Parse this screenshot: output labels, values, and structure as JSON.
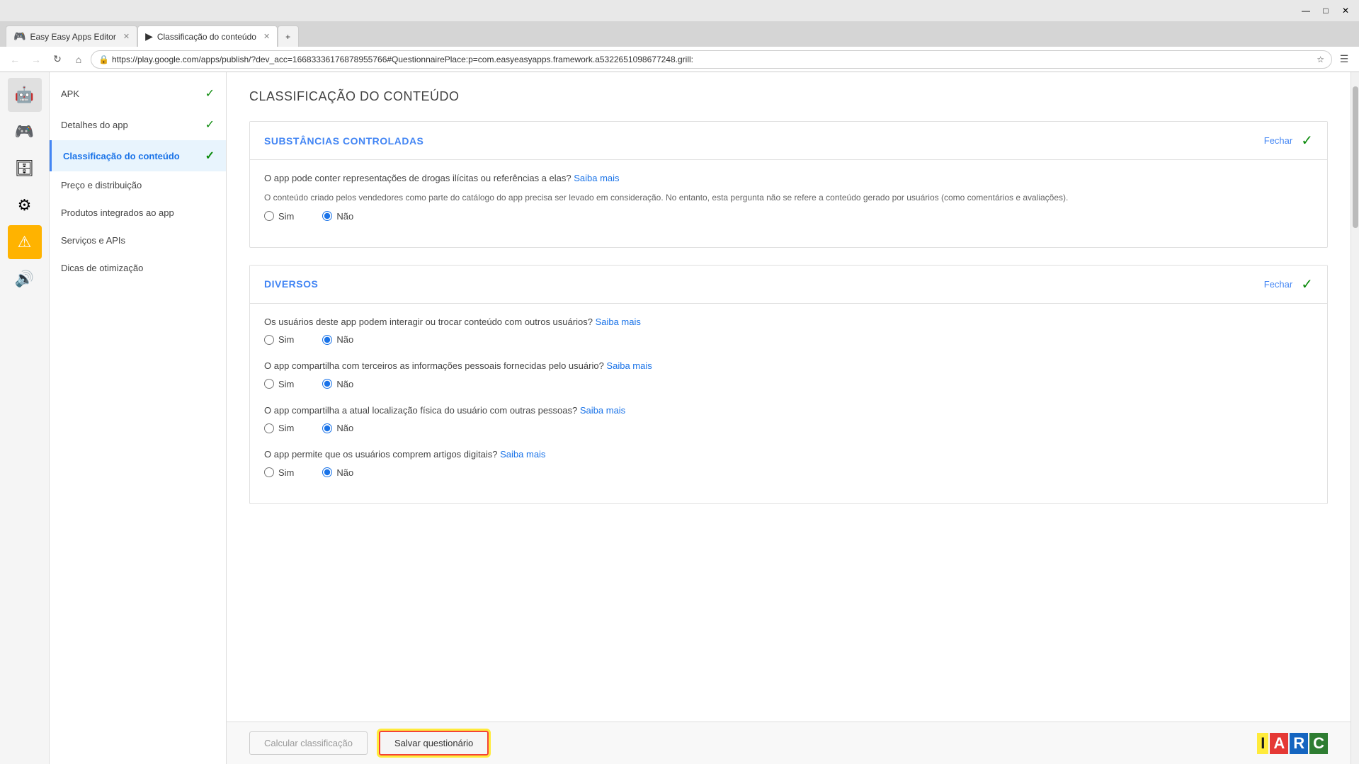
{
  "browser": {
    "title": "Easy Easy Apps Editor",
    "tabs": [
      {
        "id": "tab1",
        "label": "Easy Easy Apps Editor",
        "icon": "🎮",
        "active": false
      },
      {
        "id": "tab2",
        "label": "Classificação do conteúdo",
        "icon": "▶",
        "active": true
      }
    ],
    "address": "https://play.google.com/apps/publish/?dev_acc=16683336176878955766#QuestionnairePlace:p=com.easyeasyapps.framework.a5322651098677248.grill:"
  },
  "sidebar_icons": [
    {
      "id": "android",
      "icon": "🤖",
      "active": true
    },
    {
      "id": "gamepad",
      "icon": "🎮",
      "active": false
    },
    {
      "id": "database",
      "icon": "🗄",
      "active": false
    },
    {
      "id": "settings",
      "icon": "⚙",
      "active": false
    },
    {
      "id": "warning",
      "icon": "⚠",
      "active": false,
      "style": "warning"
    },
    {
      "id": "speaker",
      "icon": "🔊",
      "active": false
    }
  ],
  "nav_items": [
    {
      "id": "apk",
      "label": "APK",
      "check": true,
      "active": false
    },
    {
      "id": "detalhes",
      "label": "Detalhes do app",
      "check": true,
      "active": false
    },
    {
      "id": "classificacao",
      "label": "Classificação do conteúdo",
      "check": true,
      "active": true
    },
    {
      "id": "preco",
      "label": "Preço e distribuição",
      "check": false,
      "active": false
    },
    {
      "id": "produtos",
      "label": "Produtos integrados ao app",
      "check": false,
      "active": false
    },
    {
      "id": "servicos",
      "label": "Serviços e APIs",
      "check": false,
      "active": false
    },
    {
      "id": "dicas",
      "label": "Dicas de otimização",
      "check": false,
      "active": false
    }
  ],
  "page": {
    "title": "CLASSIFICAÇÃO DO CONTEÚDO",
    "sections": [
      {
        "id": "substancias",
        "title": "SUBSTÂNCIAS CONTROLADAS",
        "fechar_label": "Fechar",
        "is_complete": true,
        "questions": [
          {
            "id": "q1",
            "text": "O app pode conter representações de drogas ilícitas ou referências a elas?",
            "saiba_mais": "Saiba mais",
            "description": "O conteúdo criado pelos vendedores como parte do catálogo do app precisa ser levado em consideração. No entanto, esta pergunta não se refere a conteúdo gerado por usuários (como comentários e avaliações).",
            "options": [
              "Sim",
              "Não"
            ],
            "selected": "Não"
          }
        ]
      },
      {
        "id": "diversos",
        "title": "DIVERSOS",
        "fechar_label": "Fechar",
        "is_complete": true,
        "questions": [
          {
            "id": "q2",
            "text": "Os usuários deste app podem interagir ou trocar conteúdo com outros usuários?",
            "saiba_mais": "Saiba mais",
            "description": "",
            "options": [
              "Sim",
              "Não"
            ],
            "selected": "Não"
          },
          {
            "id": "q3",
            "text": "O app compartilha com terceiros as informações pessoais fornecidas pelo usuário?",
            "saiba_mais": "Saiba mais",
            "description": "",
            "options": [
              "Sim",
              "Não"
            ],
            "selected": "Não"
          },
          {
            "id": "q4",
            "text": "O app compartilha a atual localização física do usuário com outras pessoas?",
            "saiba_mais": "Saiba mais",
            "description": "",
            "options": [
              "Sim",
              "Não"
            ],
            "selected": "Não"
          },
          {
            "id": "q5",
            "text": "O app permite que os usuários comprem artigos digitais?",
            "saiba_mais": "Saiba mais",
            "description": "",
            "options": [
              "Sim",
              "Não"
            ],
            "selected": "Não"
          }
        ]
      }
    ],
    "bottom_bar": {
      "calcular_label": "Calcular classificação",
      "salvar_label": "Salvar questionário"
    },
    "iarc": {
      "letters": [
        "I",
        "A",
        "R",
        "C"
      ],
      "colors": [
        "#ffeb3b",
        "#e53935",
        "#1565c0",
        "#2e7d32"
      ]
    }
  }
}
